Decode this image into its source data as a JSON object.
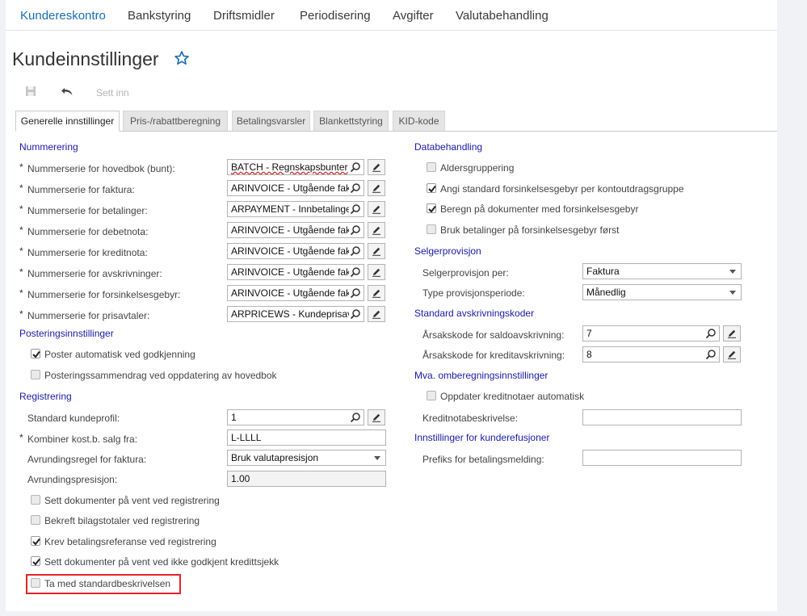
{
  "topnav": {
    "items": [
      "Kundereskontro",
      "Bankstyring",
      "Driftsmidler",
      "Periodisering",
      "Avgifter",
      "Valutabehandling"
    ]
  },
  "page_title": "Kundeinnstillinger",
  "toolbar": {
    "insert_label": "Sett inn"
  },
  "tabs": [
    "Generelle innstillinger",
    "Pris-/rabattberegning",
    "Betalingsvarsler",
    "Blankettstyring",
    "KID-kode"
  ],
  "left": {
    "numbering": {
      "title": "Nummerering",
      "fields": [
        {
          "label": "Nummerserie for hovedbok (bunt):",
          "value": "BATCH - Regnskapsbunter"
        },
        {
          "label": "Nummerserie for faktura:",
          "value": "ARINVOICE - Utgående fakt"
        },
        {
          "label": "Nummerserie for betalinger:",
          "value": "ARPAYMENT - Innbetalinger"
        },
        {
          "label": "Nummerserie for debetnota:",
          "value": "ARINVOICE - Utgående fakt"
        },
        {
          "label": "Nummerserie for kreditnota:",
          "value": "ARINVOICE - Utgående fakt"
        },
        {
          "label": "Nummerserie for avskrivninger:",
          "value": "ARINVOICE - Utgående fakt"
        },
        {
          "label": "Nummerserie for forsinkelsesgebyr:",
          "value": "ARINVOICE - Utgående fakt"
        },
        {
          "label": "Nummerserie for prisavtaler:",
          "value": "ARPRICEWS - Kundeprisavt"
        }
      ]
    },
    "posting": {
      "title": "Posteringsinnstillinger",
      "auto_post": "Poster automatisk ved godkjenning",
      "summary": "Posteringssammendrag ved oppdatering av hovedbok"
    },
    "registration": {
      "title": "Registrering",
      "profile_label": "Standard kundeprofil:",
      "profile_value": "1",
      "combine_label": "Kombiner kost.b. salg fra:",
      "combine_value": "L-LLLL",
      "rounding_rule_label": "Avrundingsregel for faktura:",
      "rounding_rule_value": "Bruk valutapresisjon",
      "rounding_precision_label": "Avrundingspresisjon:",
      "rounding_precision_value": "1.00",
      "hold_on_entry": "Sett dokumenter på vent ved registrering",
      "confirm_totals": "Bekreft bilagstotaler ved registrering",
      "require_payment_ref": "Krev betalingsreferanse ved registrering",
      "hold_failed_credit": "Sett dokumenter på vent ved ikke godkjent kredittsjekk",
      "include_default_desc": "Ta med standardbeskrivelsen"
    }
  },
  "right": {
    "data_processing": {
      "title": "Databehandling",
      "aging": "Aldersgruppering",
      "default_fee": "Angi standard forsinkelsesgebyr per kontoutdragsgruppe",
      "calc_fee": "Beregn på dokumenter med forsinkelsesgebyr",
      "payments_first": "Bruk betalinger på forsinkelsesgebyr først"
    },
    "commission": {
      "title": "Selgerprovisjon",
      "per_label": "Selgerprovisjon per:",
      "per_value": "Faktura",
      "period_label": "Type provisjonsperiode:",
      "period_value": "Månedlig"
    },
    "writeoff": {
      "title": "Standard avskrivningskoder",
      "balance_label": "Årsakskode for saldoavskrivning:",
      "balance_value": "7",
      "credit_label": "Årsakskode for kreditavskrivning:",
      "credit_value": "8"
    },
    "vat": {
      "title": "Mva. omberegningsinnstillinger",
      "update_credit": "Oppdater kreditnotaer automatisk",
      "credit_desc_label": "Kreditnotabeskrivelse:",
      "credit_desc_value": ""
    },
    "refunds": {
      "title": "Innstillinger for kunderefusjoner",
      "prefix_label": "Prefiks for betalingsmelding:",
      "prefix_value": ""
    }
  },
  "colors": {
    "accent": "#1a6db5",
    "section": "#1a1aa8",
    "highlight": "#e3242b"
  }
}
